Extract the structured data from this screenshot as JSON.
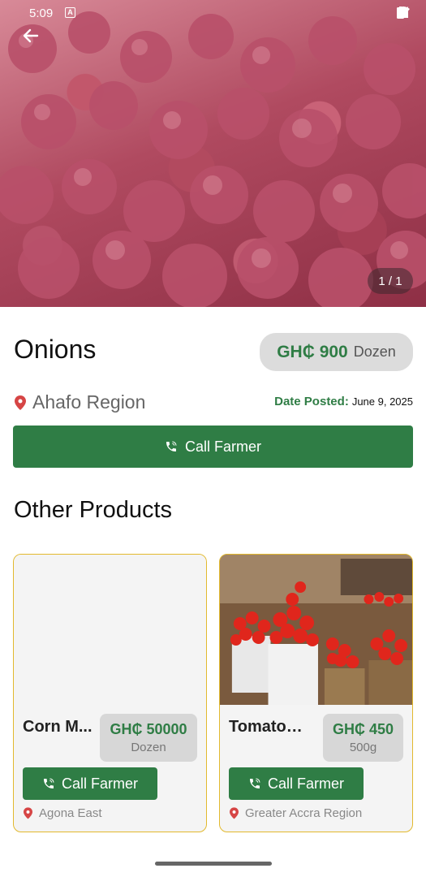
{
  "status_bar": {
    "time": "5:09",
    "notification_letter": "A"
  },
  "hero": {
    "image_counter": "1 / 1"
  },
  "product": {
    "name": "Onions",
    "price": "GH₵ 900",
    "unit": "Dozen",
    "location": "Ahafo Region",
    "date_label": "Date Posted:",
    "date_value": "June 9, 2025",
    "call_label": "Call Farmer"
  },
  "other_products": {
    "title": "Other Products",
    "items": [
      {
        "name": "Corn M...",
        "price": "GH₵ 50000",
        "unit": "Dozen",
        "call_label": "Call Farmer",
        "location": "Agona East"
      },
      {
        "name": "Tomatoes",
        "price": "GH₵ 450",
        "unit": "500g",
        "call_label": "Call Farmer",
        "location": "Greater Accra Region"
      }
    ]
  },
  "colors": {
    "accent_green": "#2f7d45",
    "card_border": "#e2b92e",
    "location_pin": "#d64545"
  }
}
